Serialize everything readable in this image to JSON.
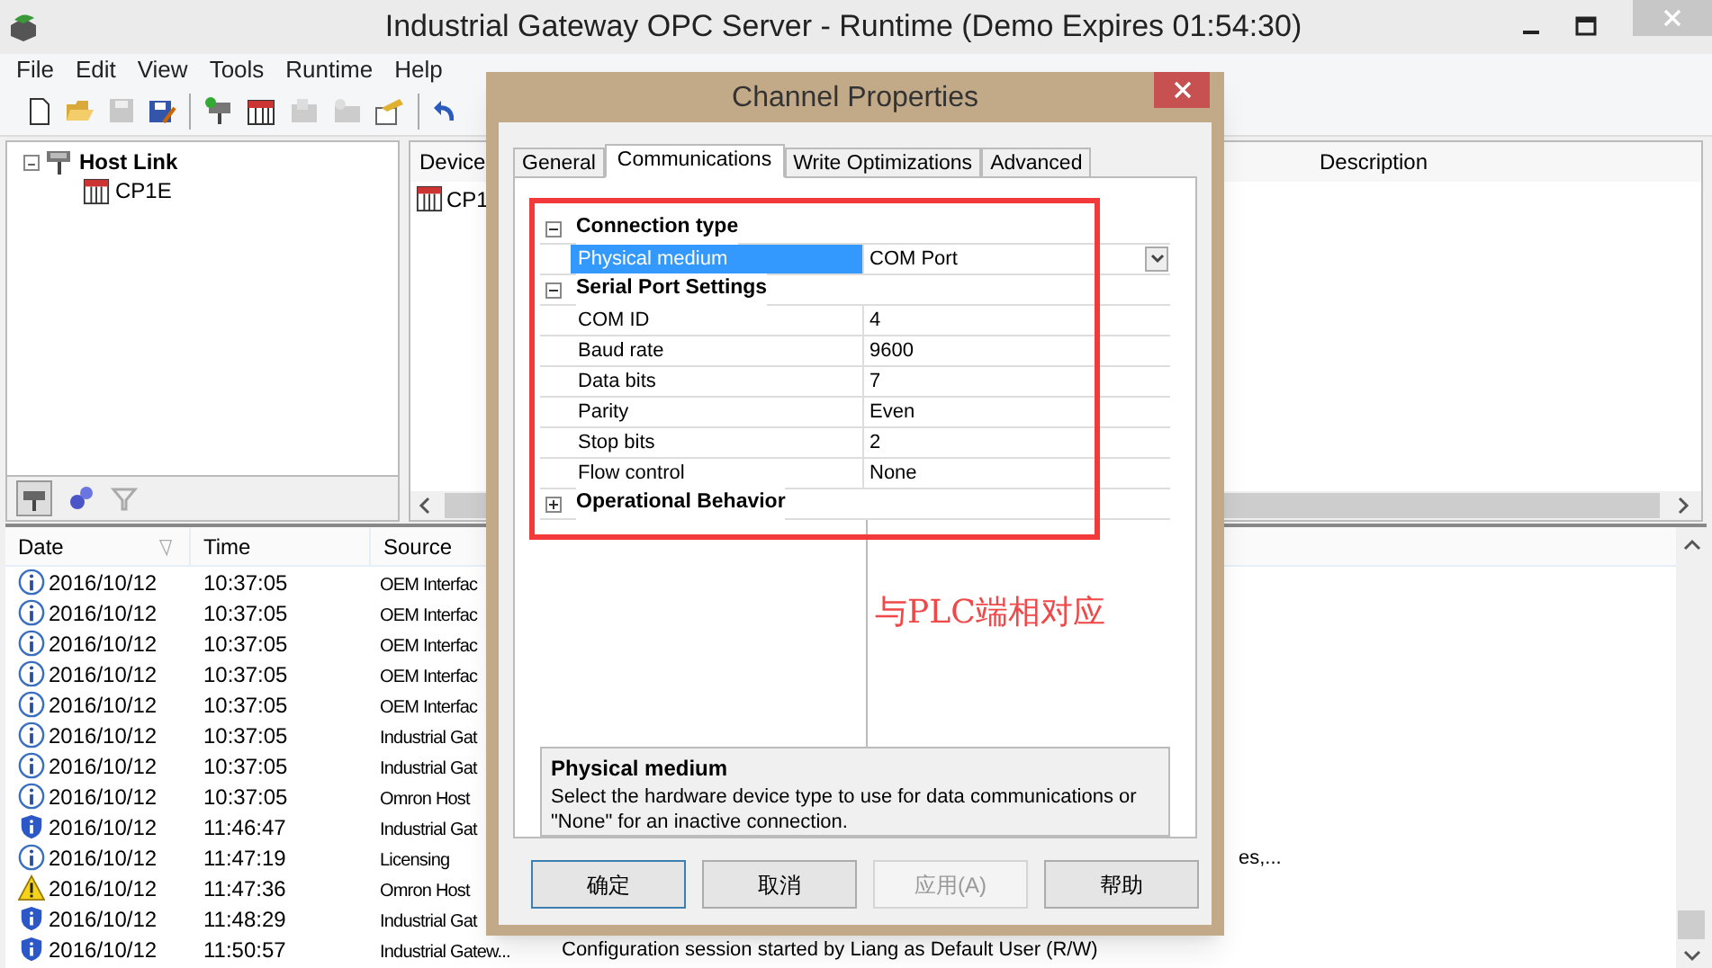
{
  "window": {
    "title": "Industrial Gateway OPC Server - Runtime (Demo Expires 01:54:30)"
  },
  "menu": [
    "File",
    "Edit",
    "View",
    "Tools",
    "Runtime",
    "Help"
  ],
  "tree": [
    {
      "label": "Host Link",
      "expanded": true,
      "children": [
        {
          "label": "CP1E"
        }
      ]
    }
  ],
  "device_list": {
    "columns": [
      "Device",
      "Description"
    ],
    "rows": [
      "CP1"
    ]
  },
  "event_log": {
    "columns": [
      "Date",
      "Time",
      "Source"
    ],
    "rows": [
      {
        "kind": "info",
        "date": "2016/10/12",
        "time": "10:37:05",
        "source": "OEM Interfac"
      },
      {
        "kind": "info",
        "date": "2016/10/12",
        "time": "10:37:05",
        "source": "OEM Interfac"
      },
      {
        "kind": "info",
        "date": "2016/10/12",
        "time": "10:37:05",
        "source": "OEM Interfac"
      },
      {
        "kind": "info",
        "date": "2016/10/12",
        "time": "10:37:05",
        "source": "OEM Interfac"
      },
      {
        "kind": "info",
        "date": "2016/10/12",
        "time": "10:37:05",
        "source": "OEM Interfac"
      },
      {
        "kind": "info",
        "date": "2016/10/12",
        "time": "10:37:05",
        "source": "Industrial Gat"
      },
      {
        "kind": "info",
        "date": "2016/10/12",
        "time": "10:37:05",
        "source": "Industrial Gat"
      },
      {
        "kind": "info",
        "date": "2016/10/12",
        "time": "10:37:05",
        "source": "Omron Host"
      },
      {
        "kind": "shield",
        "date": "2016/10/12",
        "time": "11:46:47",
        "source": "Industrial Gat"
      },
      {
        "kind": "info",
        "date": "2016/10/12",
        "time": "11:47:19",
        "source": "Licensing",
        "message": "es,..."
      },
      {
        "kind": "warning",
        "date": "2016/10/12",
        "time": "11:47:36",
        "source": "Omron Host"
      },
      {
        "kind": "shield",
        "date": "2016/10/12",
        "time": "11:48:29",
        "source": "Industrial Gat"
      },
      {
        "kind": "shield",
        "date": "2016/10/12",
        "time": "11:50:57",
        "source": "Industrial Gatew...",
        "message": "Configuration session started by Liang as Default User (R/W)"
      }
    ]
  },
  "dialog": {
    "title": "Channel Properties",
    "tabs": [
      {
        "label": "General",
        "selected": false
      },
      {
        "label": "Communications",
        "selected": true
      },
      {
        "label": "Write Optimizations",
        "selected": false
      },
      {
        "label": "Advanced",
        "selected": false
      }
    ],
    "groups": [
      {
        "label": "Connection type",
        "expanded": true,
        "properties": [
          {
            "name": "Physical medium",
            "value": "COM Port",
            "selected": true
          }
        ]
      },
      {
        "label": "Serial Port Settings",
        "expanded": true,
        "properties": [
          {
            "name": "COM ID",
            "value": "4",
            "selected": false
          },
          {
            "name": "Baud rate",
            "value": "9600",
            "selected": false
          },
          {
            "name": "Data bits",
            "value": "7",
            "selected": false
          },
          {
            "name": "Parity",
            "value": "Even",
            "selected": false
          },
          {
            "name": "Stop bits",
            "value": "2",
            "selected": false
          },
          {
            "name": "Flow control",
            "value": "None",
            "selected": false
          }
        ]
      },
      {
        "label": "Operational Behavior",
        "expanded": false
      }
    ],
    "help": {
      "title": "Physical medium",
      "text": "Select the hardware device type to use for data communications or \"None\" for an inactive connection."
    },
    "buttons": [
      {
        "label": "确定",
        "default": true,
        "disabled": false
      },
      {
        "label": "取消",
        "default": false,
        "disabled": false
      },
      {
        "label": "应用(A)",
        "default": false,
        "disabled": true
      },
      {
        "label": "帮助",
        "default": false,
        "disabled": false
      }
    ]
  },
  "annotation": "与PLC端相对应"
}
